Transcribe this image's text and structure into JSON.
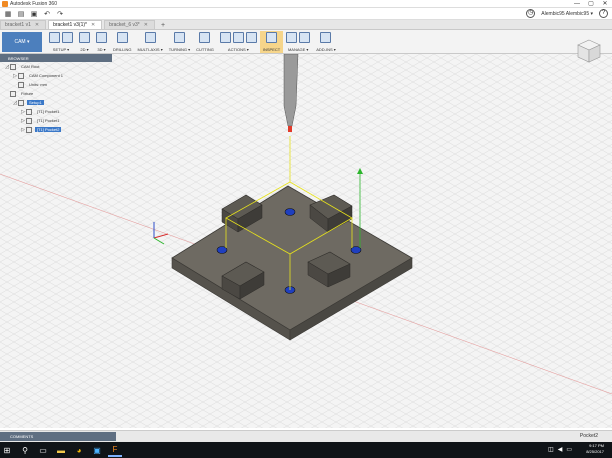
{
  "window": {
    "title": "Autodesk Fusion 360",
    "controls": [
      "—",
      "▢",
      "✕"
    ]
  },
  "qat": {
    "user": "Alembic95 Alembic95 ▾",
    "help": "?"
  },
  "tabs": [
    {
      "label": "bracket1 v1",
      "active": false
    },
    {
      "label": "bracket1 v3(1)*",
      "active": true
    },
    {
      "label": "bracket_6 v3*",
      "active": false
    }
  ],
  "workspace": "CAM ▾",
  "toolbar_groups": [
    {
      "label": "SETUP ▾",
      "icons": 2
    },
    {
      "label": "2D ▾",
      "icons": 1
    },
    {
      "label": "3D ▾",
      "icons": 1
    },
    {
      "label": "DRILLING",
      "icons": 1
    },
    {
      "label": "MULTI-AXIS ▾",
      "icons": 1
    },
    {
      "label": "TURNING ▾",
      "icons": 1
    },
    {
      "label": "CUTTING",
      "icons": 1
    },
    {
      "label": "ACTIONS ▾",
      "icons": 3
    },
    {
      "label": "INSPECT",
      "icons": 1,
      "highlight": true
    },
    {
      "label": "MANAGE ▾",
      "icons": 2
    },
    {
      "label": "ADD-INS ▾",
      "icons": 1
    }
  ],
  "browser": {
    "header": "BROWSER",
    "rows": [
      {
        "label": "CAM Root",
        "indent": 0,
        "exp": "◿",
        "selected": false
      },
      {
        "label": "CAM Component 1",
        "indent": 1,
        "exp": "▷",
        "selected": false
      },
      {
        "label": "Units: mm",
        "indent": 1,
        "exp": "",
        "selected": false
      },
      {
        "label": "Fixture",
        "indent": 0,
        "exp": "",
        "selected": false
      },
      {
        "label": "Setup1",
        "indent": 1,
        "exp": "◿",
        "selected": true
      },
      {
        "label": "[T1] Pocket1",
        "indent": 2,
        "exp": "▷",
        "selected": false
      },
      {
        "label": "[T1] Pocket1",
        "indent": 2,
        "exp": "▷",
        "selected": false
      },
      {
        "label": "[T1] Pocket2",
        "indent": 2,
        "exp": "▷",
        "selected": true
      }
    ]
  },
  "bottom": {
    "comments": "COMMENTS",
    "status": "Pocket2"
  },
  "taskbar": {
    "time": "9:17 PM",
    "date": "8/25/2017"
  },
  "colors": {
    "accent": "#4c7fbd",
    "selection": "#3a78c8",
    "part": "#6e6a62",
    "hole": "#1f3fbf",
    "axis_green": "#2cb52c",
    "axis_red": "#d62c2c"
  }
}
